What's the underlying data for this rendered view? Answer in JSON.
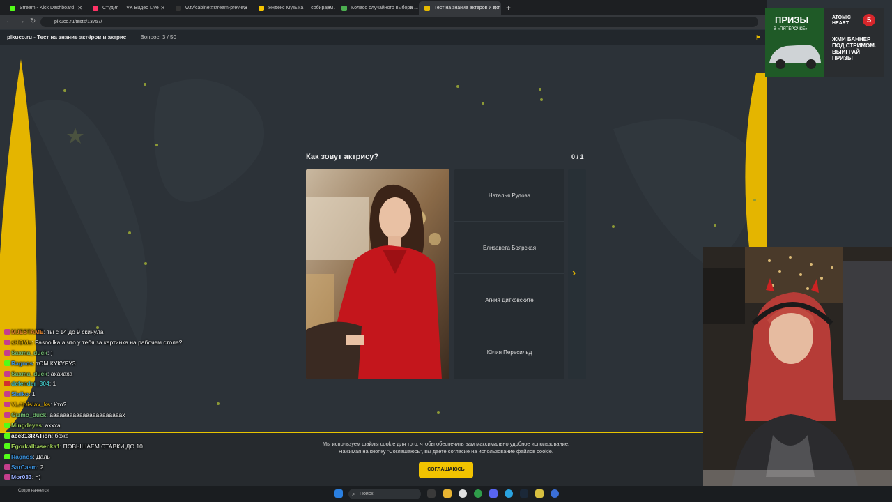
{
  "browser": {
    "tabs": [
      {
        "label": "Stream - Kick Dashboard",
        "color": "#53fc18",
        "active": false
      },
      {
        "label": "Студия — VK Видео Live",
        "color": "#ff3366",
        "active": false
      },
      {
        "label": "w.tv/cabinet#stream-preview",
        "color": "#333333",
        "active": false
      },
      {
        "label": "Яндекс Музыка — собираем ...",
        "color": "#f5c400",
        "active": false
      },
      {
        "label": "Колесо случайного выбора ...",
        "color": "#4caf50",
        "active": false
      },
      {
        "label": "Тест на знание актёров и акт...",
        "color": "#e5b900",
        "active": true
      }
    ],
    "new_tab_symbol": "+",
    "url": "pikuco.ru/tests/13757/"
  },
  "site": {
    "brand": "pikuco.ru - Тест на знание актёров и актрис",
    "question_counter": "Вопрос: 3 / 50"
  },
  "quiz": {
    "question": "Как зовут актрису?",
    "score": "0 / 1",
    "options": [
      "Наталья Рудова",
      "Елизавета Боярская",
      "Агния Дитковските",
      "Юлия Пересильд"
    ]
  },
  "cookie": {
    "line1": "Мы используем файлы cookie для того, чтобы обеспечить вам максимально удобное использование.",
    "line2": "Нажимая на кнопку \"Соглашаюсь\", вы даете согласие на использование файлов cookie.",
    "button": "СОГЛАШАЮСЬ"
  },
  "chat": [
    {
      "user": "MJESTAME",
      "text": "ты с 14 до 9 скинула",
      "color": "#e0832e",
      "badge": "#c43e8c"
    },
    {
      "user": "sHOMe",
      "text": "Fasoollka а что у тебя за картинка на рабочем столе?",
      "color": "#d0a000",
      "badge": "#c43e8c"
    },
    {
      "user": "Saxma_duck",
      "text": ")",
      "color": "#6fb56f",
      "badge": "#c43e8c"
    },
    {
      "user": "Ragnos",
      "text": "тОМ КУКУРУЗ",
      "color": "#3a8fd8",
      "badge": "#53fc18"
    },
    {
      "user": "Saxma_duck",
      "text": "ахахаха",
      "color": "#6fb56f",
      "badge": "#c43e8c"
    },
    {
      "user": "defender_304",
      "text": "1",
      "color": "#3fb3b3",
      "badge": "#d03030"
    },
    {
      "user": "Slaiko",
      "text": "1",
      "color": "#3a8fd8",
      "badge": "#c43e8c"
    },
    {
      "user": "VLADislav_ks",
      "text": "Кто?",
      "color": "#d0a000",
      "badge": "#c43e8c"
    },
    {
      "user": "Gizmo_duck",
      "text": "аааааааааааааааааааааах",
      "color": "#6fb56f",
      "badge": "#c43e8c"
    },
    {
      "user": "Mingdeyes",
      "text": "ахxха",
      "color": "#a6d85a",
      "badge": "#53fc18"
    },
    {
      "user": "acc313RATion",
      "text": "боже",
      "color": "#f0f0f0",
      "badge": "#53fc18"
    },
    {
      "user": "Egorkalbasenka1",
      "text": "ПОВЫШАЕМ СТАВКИ ДО 10",
      "color": "#a6d85a",
      "badge": "#53fc18"
    },
    {
      "user": "Ragnos",
      "text": "Даль",
      "color": "#3a8fd8",
      "badge": "#53fc18"
    },
    {
      "user": "SarCasm",
      "text": "2",
      "color": "#3a8fd8",
      "badge": "#c43e8c"
    },
    {
      "user": "Mor033",
      "text": "=)",
      "color": "#9ab0ff",
      "badge": "#c43e8c"
    }
  ],
  "taskbar": {
    "search": "Поиск",
    "notify": "Скоро начнется"
  },
  "ad": {
    "title": "ПРИЗЫ",
    "subtitle": "В «ПЯТЁРОЧКЕ»",
    "brand_top": "ATOMIC",
    "brand_bottom": "HEART",
    "badge": "5",
    "cta": "ЖМИ БАННЕР ПОД СТРИМОМ. ВЫИГРАЙ ПРИЗЫ"
  },
  "colors": {
    "accent": "#f2c300",
    "background": "#2c3238",
    "panel": "#262c31"
  }
}
